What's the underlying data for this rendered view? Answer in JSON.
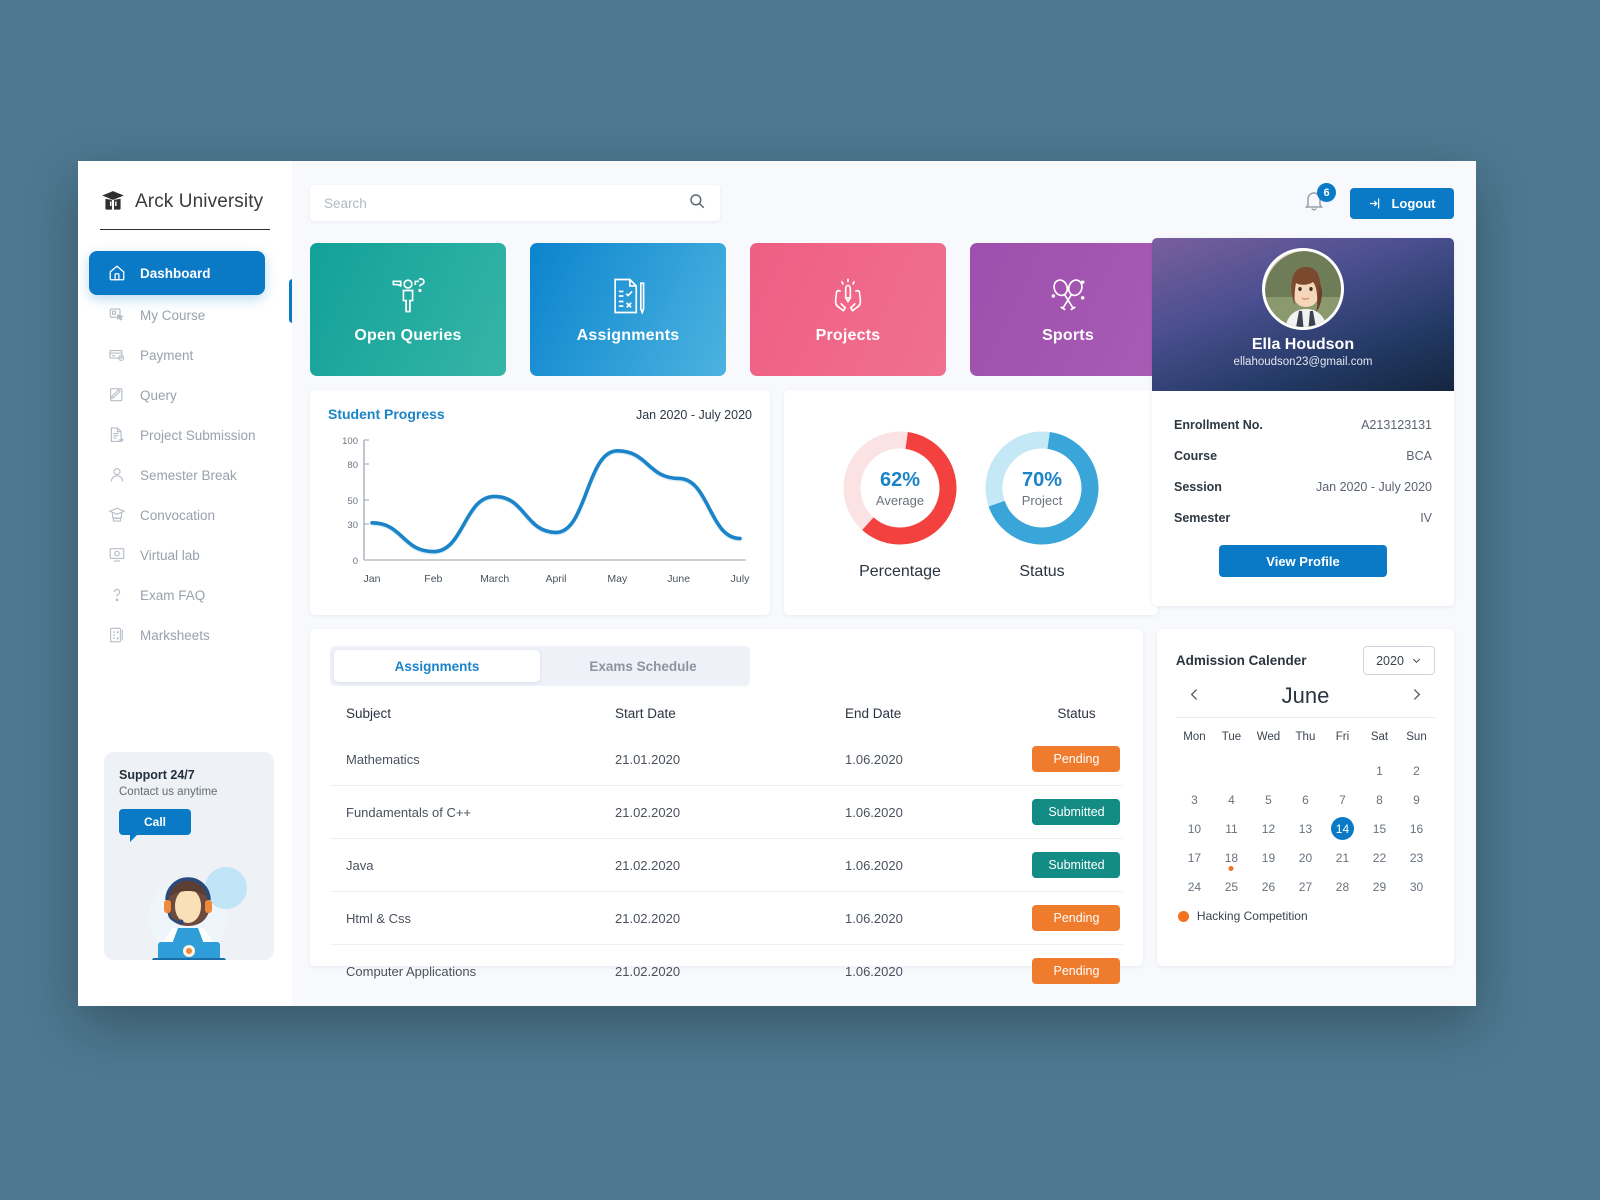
{
  "brand": {
    "name": "Arck University",
    "logo_icon": "graduation-book-icon"
  },
  "sidebar": {
    "items": [
      {
        "label": "Dashboard",
        "icon": "home-icon",
        "active": true
      },
      {
        "label": "My Course",
        "icon": "course-click-icon",
        "active": false
      },
      {
        "label": "Payment",
        "icon": "credit-card-icon",
        "active": false
      },
      {
        "label": "Query",
        "icon": "pen-note-icon",
        "active": false
      },
      {
        "label": "Project Submission",
        "icon": "document-upload-icon",
        "active": false
      },
      {
        "label": "Semester Break",
        "icon": "person-icon",
        "active": false
      },
      {
        "label": "Convocation",
        "icon": "graduation-cap-icon",
        "active": false
      },
      {
        "label": "Virtual lab",
        "icon": "monitor-icon",
        "active": false
      },
      {
        "label": "Exam FAQ",
        "icon": "question-mark-icon",
        "active": false
      },
      {
        "label": "Marksheets",
        "icon": "marksheet-icon",
        "active": false
      }
    ],
    "support": {
      "title": "Support 24/7",
      "subtitle": "Contact us anytime",
      "button": "Call"
    }
  },
  "topbar": {
    "search_placeholder": "Search",
    "search_value": "",
    "notification_count": "6",
    "logout_label": "Logout"
  },
  "tiles": [
    {
      "label": "Open Queries",
      "icon": "person-question-icon",
      "color": "#12a199"
    },
    {
      "label": "Assignments",
      "icon": "checklist-pen-icon",
      "color": "#0b84cd"
    },
    {
      "label": "Projects",
      "icon": "hands-pencil-icon",
      "color": "#ef5e84"
    },
    {
      "label": "Sports",
      "icon": "rackets-icon",
      "color": "#9d4fad"
    }
  ],
  "profile": {
    "name": "Ella Houdson",
    "email": "ellahoudson23@gmail.com",
    "avatar_icon": "user-avatar",
    "rows": [
      {
        "label": "Enrollment No.",
        "value": "A213123131"
      },
      {
        "label": "Course",
        "value": "BCA"
      },
      {
        "label": "Session",
        "value": "Jan 2020 - July 2020"
      },
      {
        "label": "Semester",
        "value": "IV"
      }
    ],
    "button": "View Profile"
  },
  "chart_data": {
    "type": "line",
    "title": "Student Progress",
    "subtitle": "Jan 2020 - July 2020",
    "categories": [
      "Jan",
      "Feb",
      "March",
      "April",
      "May",
      "June",
      "July"
    ],
    "x": [
      "Jan",
      "Feb",
      "March",
      "April",
      "May",
      "June",
      "July"
    ],
    "values": [
      31,
      7,
      53,
      23,
      91,
      68,
      18
    ],
    "series": [
      {
        "name": "Student Progress",
        "values": [
          31,
          7,
          53,
          23,
          91,
          68,
          18
        ]
      }
    ],
    "ytick_labels": [
      "100",
      "80",
      "50",
      "30",
      "0"
    ],
    "ytick_values": [
      100,
      80,
      50,
      30,
      0
    ],
    "ylim": [
      0,
      100
    ],
    "xlabel": "",
    "ylabel": "",
    "grid": false,
    "legend": "none",
    "line_color": "#1b84c8"
  },
  "donuts": {
    "items": [
      {
        "percent": "62%",
        "sub": "Average",
        "caption": "Percentage",
        "value": 62,
        "color": "#f2413f",
        "track": "#fbe3e4"
      },
      {
        "percent": "70%",
        "sub": "Project",
        "caption": "Status",
        "value": 70,
        "color": "#3aa5d8",
        "track": "#c5e8f7"
      }
    ]
  },
  "assignments": {
    "tabs": [
      {
        "label": "Assignments",
        "active": true
      },
      {
        "label": "Exams Schedule",
        "active": false
      }
    ],
    "columns": [
      "Subject",
      "Start Date",
      "End Date",
      "Status"
    ],
    "rows": [
      {
        "subject": "Mathematics",
        "start": "21.01.2020",
        "end": "1.06.2020",
        "status": "Pending",
        "status_kind": "pending"
      },
      {
        "subject": "Fundamentals of C++",
        "start": "21.02.2020",
        "end": "1.06.2020",
        "status": "Submitted",
        "status_kind": "submitted"
      },
      {
        "subject": "Java",
        "start": "21.02.2020",
        "end": "1.06.2020",
        "status": "Submitted",
        "status_kind": "submitted"
      },
      {
        "subject": "Html & Css",
        "start": "21.02.2020",
        "end": "1.06.2020",
        "status": "Pending",
        "status_kind": "pending"
      },
      {
        "subject": "Computer Applications",
        "start": "21.02.2020",
        "end": "1.06.2020",
        "status": "Pending",
        "status_kind": "pending"
      }
    ]
  },
  "calendar": {
    "title": "Admission Calender",
    "year": "2020",
    "month": "June",
    "prev_icon": "chevron-left-icon",
    "next_icon": "chevron-right-icon",
    "dow": [
      "Mon",
      "Tue",
      "Wed",
      "Thu",
      "Fri",
      "Sat",
      "Sun"
    ],
    "leading_blanks": 5,
    "days": [
      1,
      2,
      3,
      4,
      5,
      6,
      7,
      8,
      9,
      10,
      11,
      12,
      13,
      14,
      15,
      16,
      17,
      18,
      19,
      20,
      21,
      22,
      23,
      24,
      25,
      26,
      27,
      28,
      29,
      30
    ],
    "selected_day": 14,
    "event_days": [
      18
    ],
    "legend": {
      "label": "Hacking Competition",
      "color": "#f2731f"
    }
  }
}
